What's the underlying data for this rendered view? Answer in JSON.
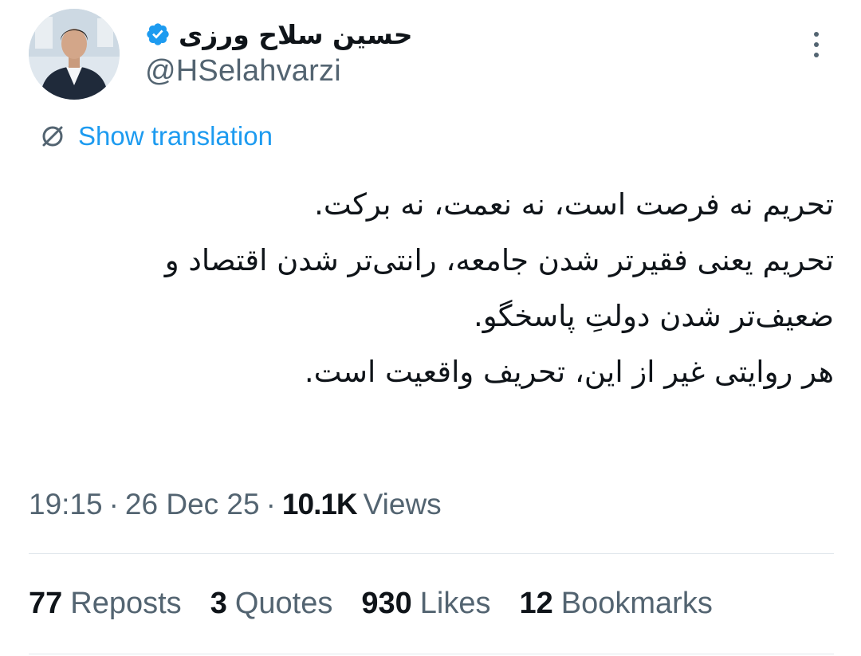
{
  "author": {
    "display_name": "حسین سلاح ورزی",
    "handle": "@HSelahvarzi",
    "verified": true
  },
  "translate_label": "Show translation",
  "tweet_lines": [
    "تحریم نه فرصت است، نه نعمت، نه برکت.",
    "تحریم یعنی فقیرتر شدن جامعه، رانتی‌تر شدن اقتصاد و",
    "ضعیف‌تر شدن دولتِ پاسخگو.",
    "هر روایتی غیر از این، تحریف واقعیت است."
  ],
  "meta": {
    "time": "19:15",
    "separator": "·",
    "date": "26 Dec 25",
    "views_count": "10.1K",
    "views_label": "Views"
  },
  "stats": {
    "reposts": {
      "count": "77",
      "label": "Reposts"
    },
    "quotes": {
      "count": "3",
      "label": "Quotes"
    },
    "likes": {
      "count": "930",
      "label": "Likes"
    },
    "bookmarks": {
      "count": "12",
      "label": "Bookmarks"
    }
  },
  "colors": {
    "link": "#1d9bf0",
    "secondary_text": "#536471",
    "primary_text": "#0f1419",
    "verified_badge": "#1d9bf0"
  },
  "icons": {
    "verified": "verified-badge-icon",
    "translate": "translate-globe-icon",
    "more": "more-dots-icon"
  }
}
